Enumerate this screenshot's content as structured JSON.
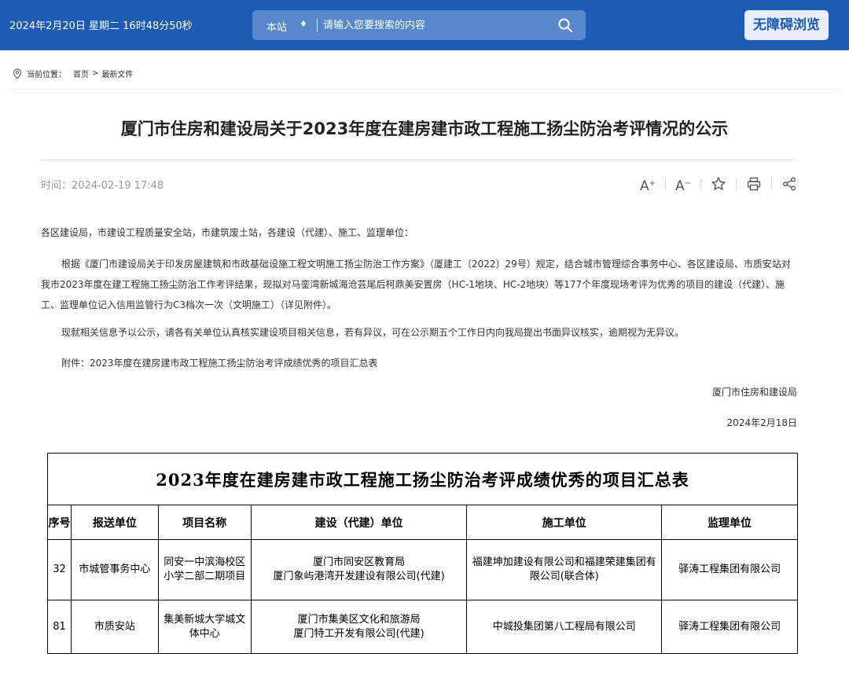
{
  "header": {
    "datetime": "2024年2月20日  星期二    16时48分50秒",
    "search_scope": "本站",
    "search_placeholder": "请输入您要搜索的内容",
    "accessibility_label": "无障碍浏览"
  },
  "breadcrumb": {
    "label": "当前位置：",
    "items": [
      "首页",
      "最新文件"
    ],
    "separator": ">"
  },
  "article": {
    "title": "厦门市住房和建设局关于2023年度在建房建市政工程施工扬尘防治考评情况的公示",
    "time": "时间：2024-02-19 17:48",
    "greeting": "各区建设局，市建设工程质量安全站，市建筑废土站，各建设（代建）、施工、监理单位：",
    "paragraph": "根据《厦门市建设局关于印发房屋建筑和市政基础设施工程文明施工扬尘防治工作方案》（厦建工〔2022〕29号）规定，结合城市管理综合事务中心、各区建设局、市质安站对我市2023年度在建工程施工扬尘防治工作考评结果，现拟对马銮湾新城海沧芸尾后柯鼎美安置房（HC-1地块、HC-2地块）等177个年度现场考评为优秀的项目的建设（代建）、施工、监理单位记入信用监管行为C3档次一次（文明施工）（详见附件）。",
    "notice": "现就相关信息予以公示，请各有关单位认真核实建设项目相关信息，若有异议，可在公示期五个工作日内向我局提出书面异议核实，逾期视为无异议。",
    "attachment": "附件：2023年度在建房建市政工程施工扬尘防治考评成绩优秀的项目汇总表",
    "signature": "厦门市住房和建设局",
    "date": "2024年2月18日"
  },
  "toolbar": {
    "font_increase": "A",
    "font_decrease": "A",
    "icons": [
      "font-increase-icon",
      "font-decrease-icon",
      "star-icon",
      "print-icon",
      "share-icon"
    ]
  },
  "table": {
    "title": "2023年度在建房建市政工程施工扬尘防治考评成绩优秀的项目汇总表",
    "headers": [
      "序号",
      "报送单位",
      "项目名称",
      "建设（代建）单位",
      "施工单位",
      "监理单位"
    ],
    "rows": [
      {
        "no": "32",
        "submitter": "市城管事务中心",
        "project": "同安一中滨海校区小学二部二期项目",
        "builder_1": "厦门市同安区教育局",
        "builder_2": "厦门象屿港湾开发建设有限公司(代建)",
        "contractor": "福建坤加建设有限公司和福建荣建集团有限公司(联合体)",
        "supervisor": "驿涛工程集团有限公司"
      },
      {
        "no": "81",
        "submitter": "市质安站",
        "project": "集美新城大学城文体中心",
        "builder_1": "厦门市集美区文化和旅游局",
        "builder_2": "厦门特工开发有限公司(代建)",
        "contractor": "中城投集团第八工程局有限公司",
        "supervisor": "驿涛工程集团有限公司"
      }
    ]
  },
  "colors": {
    "header_bg": "#1d5bb4",
    "search_bg": "#5887cc",
    "accessibility_bg": "#e8eefb"
  }
}
